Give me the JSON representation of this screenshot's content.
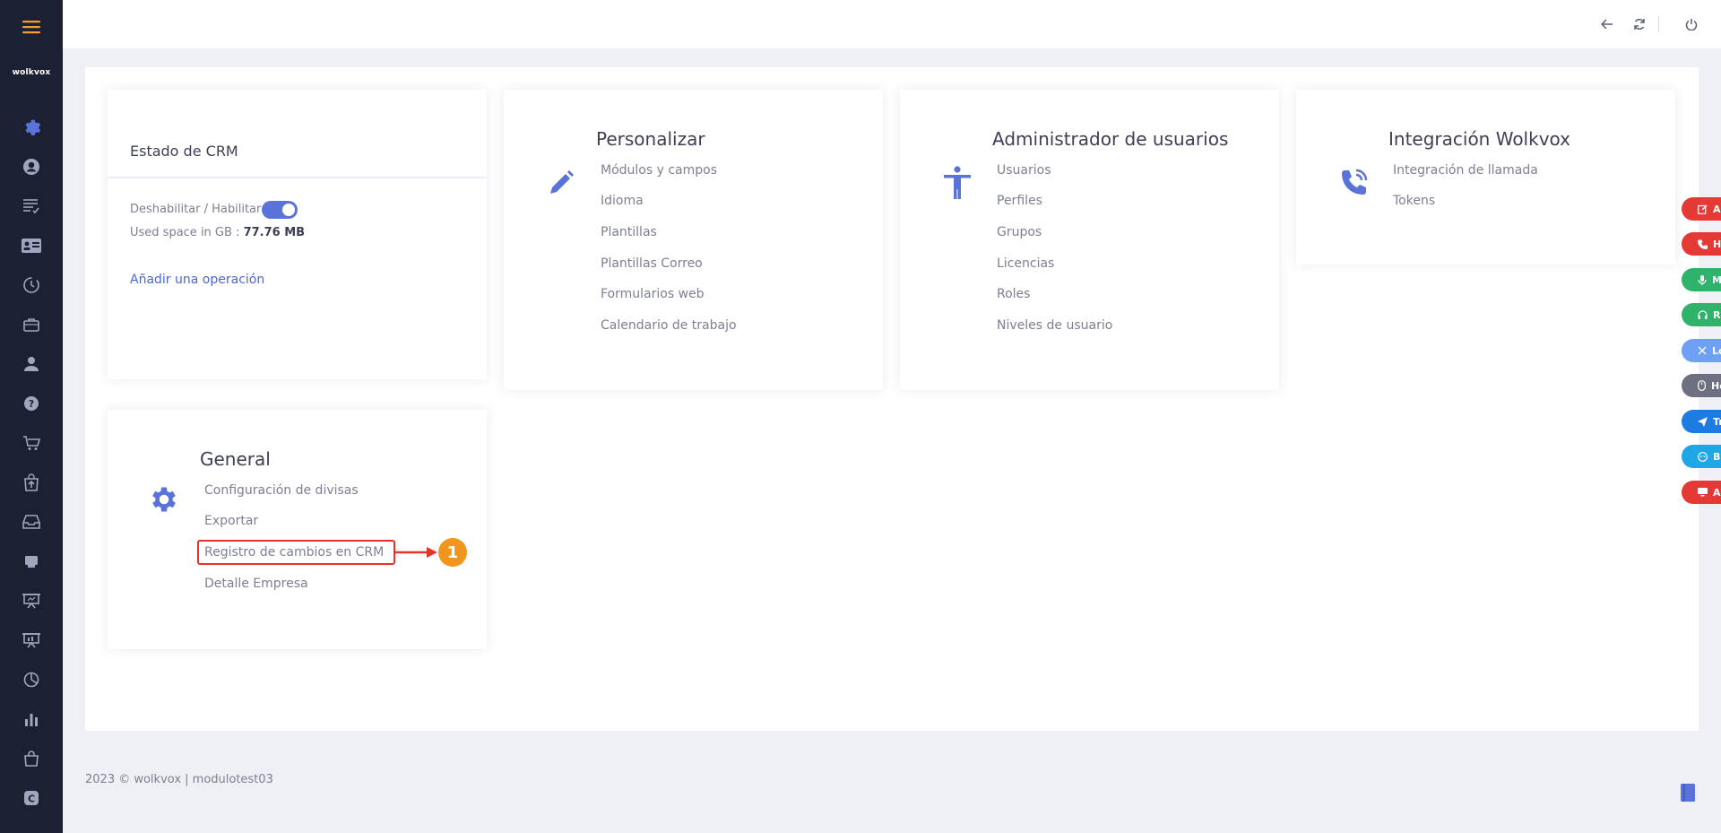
{
  "sidebar": {
    "brand": "wolkvox",
    "icons": [
      {
        "name": "settings-icon",
        "active": true
      },
      {
        "name": "user-circle-icon"
      },
      {
        "name": "task-list-icon"
      },
      {
        "name": "contact-card-icon"
      },
      {
        "name": "history-icon"
      },
      {
        "name": "briefcase-icon"
      },
      {
        "name": "person-icon"
      },
      {
        "name": "help-icon"
      },
      {
        "name": "cart-icon"
      },
      {
        "name": "bag-upload-icon"
      },
      {
        "name": "inbox-icon"
      },
      {
        "name": "store-icon"
      },
      {
        "name": "presentation-icon"
      },
      {
        "name": "presentation-alt-icon"
      },
      {
        "name": "pie-chart-icon"
      },
      {
        "name": "bar-chart-icon"
      },
      {
        "name": "shopping-bag-icon"
      },
      {
        "name": "registered-icon"
      }
    ]
  },
  "topbar": {
    "icons": [
      "back-arrow-icon",
      "refresh-icon",
      "power-icon"
    ]
  },
  "crm_card": {
    "title": "Estado de CRM",
    "toggle_label": "Deshabilitar / Habilitar",
    "toggle_on": true,
    "used_space_label": "Used space in GB :",
    "used_space_value": "77.76 MB",
    "add_operation": "Añadir una operación"
  },
  "personalizar": {
    "title": "Personalizar",
    "icon": "pencil-icon",
    "links": [
      "Módulos y campos",
      "Idioma",
      "Plantillas",
      "Plantillas Correo",
      "Formularios web",
      "Calendario de trabajo"
    ]
  },
  "admin_usuarios": {
    "title": "Administrador de usuarios",
    "icon": "person-standing-icon",
    "links": [
      "Usuarios",
      "Perfiles",
      "Grupos",
      "Licencias",
      "Roles",
      "Niveles de usuario"
    ]
  },
  "integracion": {
    "title": "Integración Wolkvox",
    "icon": "phone-call-icon",
    "links": [
      "Integración de llamada",
      "Tokens"
    ]
  },
  "general": {
    "title": "General",
    "icon": "gear-icon",
    "links": [
      "Configuración de divisas",
      "Exportar",
      "Registro de cambios en CRM",
      "Detalle Empresa"
    ],
    "highlighted_index": 2
  },
  "annotation": {
    "step_number": "1"
  },
  "footer": {
    "text": "2023 © wolkvox | modulotest03"
  },
  "floating_buttons": [
    {
      "label": "Ac",
      "color": "#e53935"
    },
    {
      "label": "Ho",
      "color": "#e53935"
    },
    {
      "label": "M",
      "color": "#2fb36b"
    },
    {
      "label": "Re",
      "color": "#2fb36b"
    },
    {
      "label": "Lo",
      "color": "#6ea0f5"
    },
    {
      "label": "He",
      "color": "#6c7080"
    },
    {
      "label": "Tr",
      "color": "#1e7be0"
    },
    {
      "label": "B.",
      "color": "#1ea7e6"
    },
    {
      "label": "Ag",
      "color": "#e53935"
    }
  ],
  "colors": {
    "sidebar_bg": "#1c2033",
    "accent": "#5a73d8",
    "hamburger": "#f0a030",
    "highlight_red": "#e5332a",
    "step_orange": "#f0951d"
  }
}
